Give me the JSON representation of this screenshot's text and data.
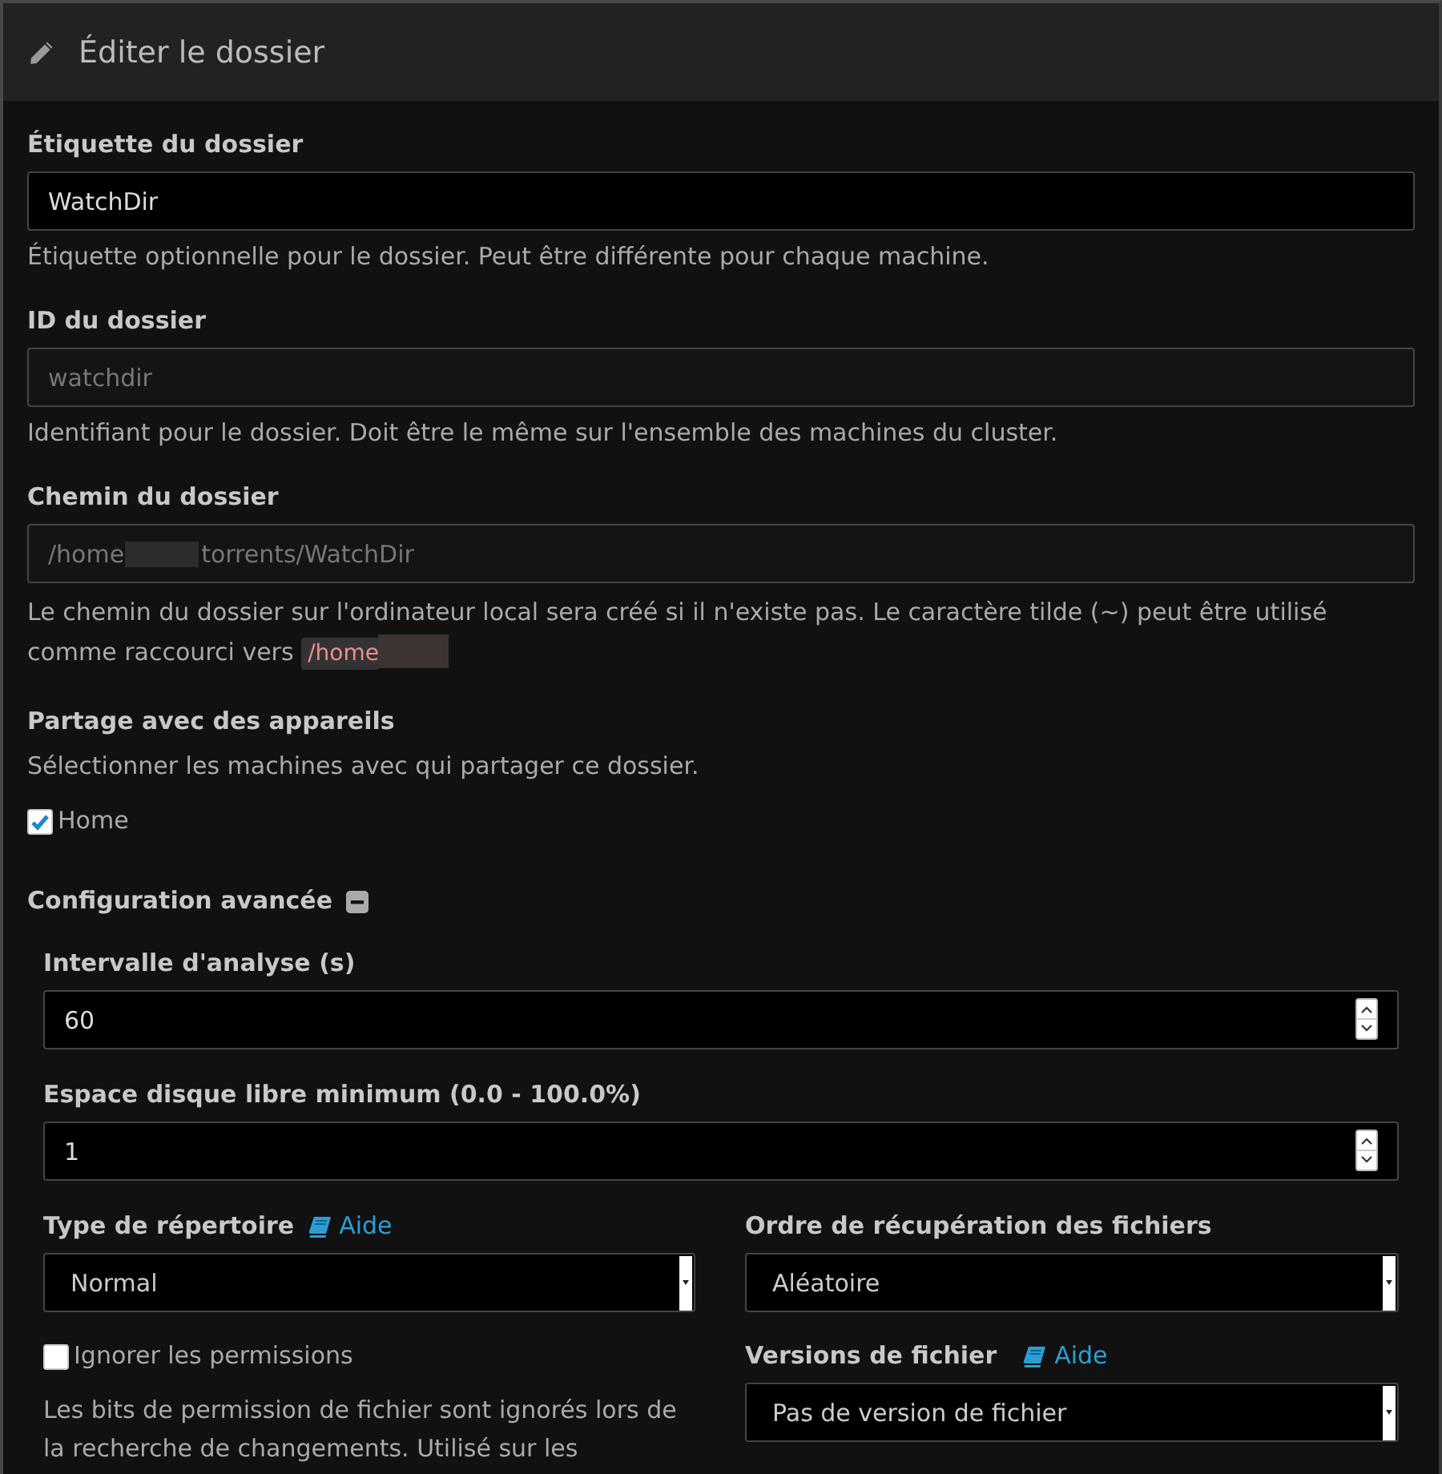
{
  "dialog": {
    "title": "Éditer le dossier"
  },
  "general_fields": [
    {
      "kind": "text",
      "label": "Étiquette du dossier",
      "value": "WatchDir",
      "disabled": false,
      "help": "Étiquette optionnelle pour le dossier. Peut être différente pour chaque machine."
    },
    {
      "kind": "text",
      "label": "ID du dossier",
      "value": "watchdir",
      "disabled": true,
      "help": "Identifiant pour le dossier. Doit être le même sur l'ensemble des machines du cluster."
    },
    {
      "kind": "path",
      "label": "Chemin du dossier",
      "value_start": "/home",
      "value_end": "torrents/WatchDir",
      "redacted": true,
      "disabled": true,
      "help": "Le chemin du dossier sur l'ordinateur local sera créé si il n'existe pas. Le caractère tilde (~) peut être utilisé comme raccourci vers",
      "help_code": "/home",
      "help_code_redacted": true
    }
  ],
  "sharing": {
    "label": "Partage avec des appareils",
    "help": "Sélectionner les machines avec qui partager ce dossier.",
    "devices": [
      {
        "name": "Home",
        "checked": true
      }
    ]
  },
  "advanced": {
    "title": "Configuration avancée",
    "expanded": true,
    "number_fields": [
      {
        "label": "Intervalle d'analyse (s)",
        "value": "60"
      },
      {
        "label": "Espace disque libre minimum (0.0 - 100.0%)",
        "value": "1"
      }
    ],
    "folder_type": {
      "label": "Type de répertoire",
      "help_link": "Aide",
      "value": "Normal"
    },
    "pull_order": {
      "label": "Ordre de récupération des fichiers",
      "value": "Aléatoire"
    },
    "ignore_permissions": {
      "label": "Ignorer les permissions",
      "checked": false,
      "help": "Les bits de permission de fichier sont ignorés lors de la recherche de changements. Utilisé sur les"
    },
    "versioning": {
      "label": "Versions de fichier",
      "help_link": "Aide",
      "value": "Pas de version de fichier"
    }
  }
}
